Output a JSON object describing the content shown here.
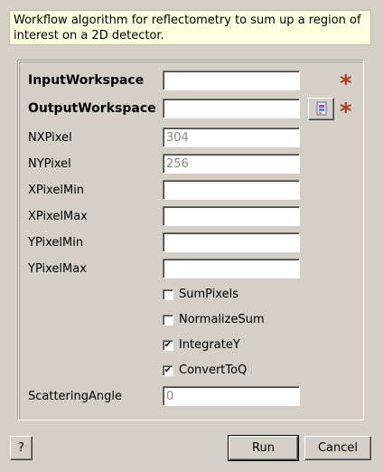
{
  "description": "Workflow algorithm for reflectometry to sum up a region of interest on a 2D detector.",
  "fields": [
    {
      "label": "InputWorkspace",
      "value": "",
      "required": true,
      "enabled": true
    },
    {
      "label": "OutputWorkspace",
      "value": "",
      "required": true,
      "enabled": true,
      "browse_icon": "workspace-browse-icon"
    },
    {
      "label": "NXPixel",
      "value": "304",
      "enabled": false
    },
    {
      "label": "NYPixel",
      "value": "256",
      "enabled": false
    },
    {
      "label": "XPixelMin",
      "value": "",
      "enabled": true
    },
    {
      "label": "XPixelMax",
      "value": "",
      "enabled": true
    },
    {
      "label": "YPixelMin",
      "value": "",
      "enabled": true
    },
    {
      "label": "YPixelMax",
      "value": "",
      "enabled": true
    }
  ],
  "checkboxes": [
    {
      "label": "SumPixels",
      "checked": false
    },
    {
      "label": "NormalizeSum",
      "checked": false
    },
    {
      "label": "IntegrateY",
      "checked": true
    },
    {
      "label": "ConvertToQ",
      "checked": true
    }
  ],
  "scattering": {
    "label": "ScatteringAngle",
    "value": "0",
    "enabled": false
  },
  "required_marker": "*",
  "check_mark": "✔",
  "buttons": {
    "help": "?",
    "run": "Run",
    "cancel": "Cancel"
  },
  "colors": {
    "background": "#d4d0c8",
    "description_bg": "#ffffe1",
    "required_star": "#b03a20"
  }
}
